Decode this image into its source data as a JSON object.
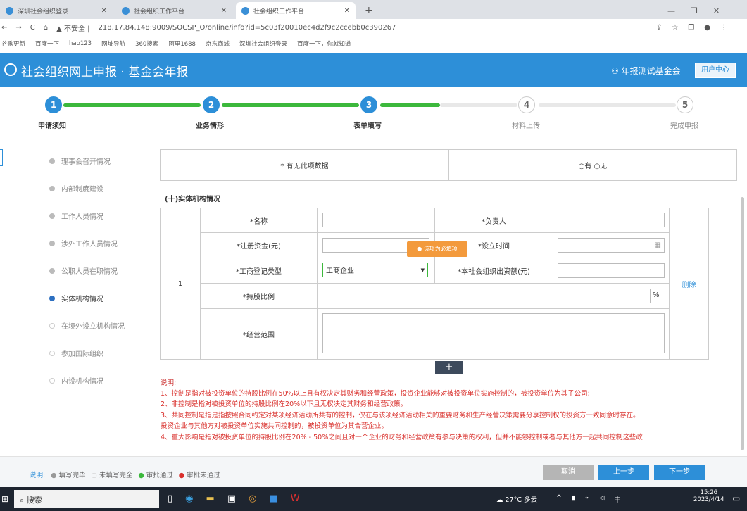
{
  "browser": {
    "tabs": [
      {
        "label": "深圳社会组织登录"
      },
      {
        "label": "社会组织工作平台"
      },
      {
        "label": "社会组织工作平台"
      }
    ],
    "new_tab": "+",
    "url_warning": "不安全",
    "url": "218.17.84.148:9009/SOCSP_O/online/info?id=5c03f20010ec4d2f9c2ccebb0c390267",
    "bookmarks": [
      "谷歌更新",
      "百度一下",
      "hao123",
      "网址导航",
      "360搜索",
      "阿里1688",
      "京东商城",
      "深圳社会组织登录",
      "百度一下，你就知道"
    ]
  },
  "header": {
    "title": "社会组织网上申报 · 基金会年报",
    "user": "年报测试基金会",
    "user_center": "用户中心"
  },
  "steps": [
    {
      "num": "1",
      "label": "申请须知",
      "done": true
    },
    {
      "num": "2",
      "label": "业务情形",
      "done": true
    },
    {
      "num": "3",
      "label": "表单填写",
      "done": true
    },
    {
      "num": "4",
      "label": "材料上传",
      "done": false
    },
    {
      "num": "5",
      "label": "完成申报",
      "done": false
    }
  ],
  "sidebar": [
    {
      "label": "理事会召开情况",
      "state": "done"
    },
    {
      "label": "内部制度建设",
      "state": "done"
    },
    {
      "label": "工作人员情况",
      "state": "done"
    },
    {
      "label": "涉外工作人员情况",
      "state": "done"
    },
    {
      "label": "公职人员在职情况",
      "state": "done"
    },
    {
      "label": "实体机构情况",
      "state": "current"
    },
    {
      "label": "在境外设立机构情况",
      "state": "todo"
    },
    {
      "label": "参加国际组织",
      "state": "todo"
    },
    {
      "label": "内设机构情况",
      "state": "todo"
    }
  ],
  "form": {
    "has_data_label": "* 有无此项数据",
    "has_data_options": "○有 ○无",
    "section_title": "(十)实体机构情况",
    "row_index": "1",
    "name_label": "*名称",
    "leader_label": "*负责人",
    "capital_label": "*注册资金(元)",
    "established_label": "*设立时间",
    "type_label": "*工商登记类型",
    "type_value": "工商企业",
    "invest_label": "*本社会组织出资额(元)",
    "share_label": "*持股比例",
    "percent": "%",
    "scope_label": "*经营范围",
    "tooltip": "● 该项为必填项",
    "delete": "删除",
    "add": "+"
  },
  "notes": {
    "title": "说明:",
    "items": [
      "1、控制是指对被投资单位的持股比例在50%以上且有权决定其财务和经营政策，投资企业能够对被投资单位实施控制的，被投资单位为其子公司;",
      "2、非控制是指对被投资单位的持股比例在20%以下且无权决定其财务和经营政策。",
      "3、共同控制是指是指按照合同约定对某项经济活动所共有的控制，仅在与该项经济活动相关的重要财务和生产经营决策需要分享控制权的投资方一致同意时存在。",
      "投资企业与其他方对被投资单位实施共同控制的，被投资单位为其合营企业。",
      "4、重大影响是指对被投资单位的持股比例在20% - 50%之间且对一个企业的财务和经营政策有参与决策的权利，但并不能够控制或者与其他方一起共同控制这些政"
    ]
  },
  "footer": {
    "legend_label": "说明:",
    "legend": [
      "填写完毕",
      "未填写完全",
      "审批通过",
      "审批未通过"
    ],
    "cancel": "取消",
    "prev": "上一步",
    "next": "下一步"
  },
  "taskbar": {
    "search": "搜索",
    "weather": "27°C 多云",
    "ime": "中",
    "time": "15:26",
    "date": "2023/4/14"
  },
  "colors": {
    "primary": "#2d8fd8",
    "progress": "#3cb83c",
    "note": "#d9302c",
    "tooltip": "#f39a3c"
  }
}
